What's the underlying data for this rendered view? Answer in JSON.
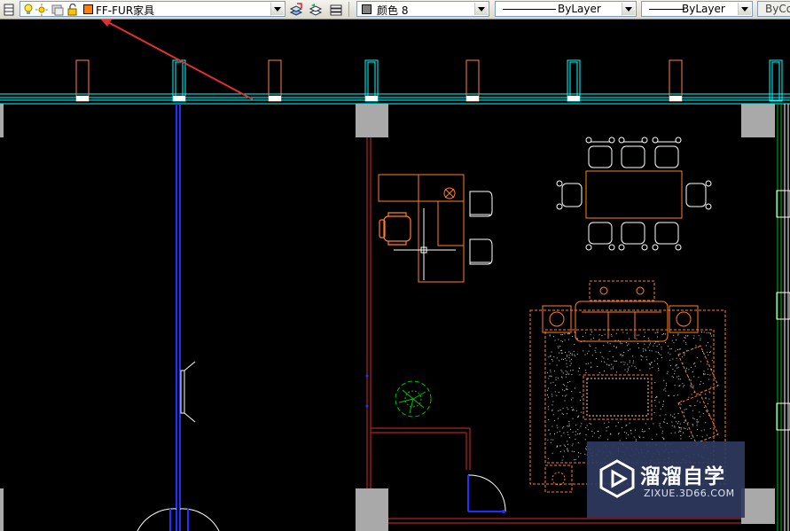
{
  "toolbar": {
    "layer_name": "FF-FUR家具",
    "layer_color": "#ff7f00",
    "color_label": "颜色 8",
    "color_swatch": "#808080",
    "linetype": "ByLayer",
    "lineweight": "ByLayer",
    "plotstyle": "ByCo"
  },
  "icons": {
    "layer_manager": "layer-properties-icon",
    "bulb": "layer-on-bulb-icon",
    "sun": "layer-thaw-sun-icon",
    "lock": "layer-unlock-icon",
    "make_current": "make-object-layer-current-icon",
    "layer_previous": "layer-previous-icon",
    "layer_states": "layer-states-icon"
  },
  "watermark": {
    "title": "溜溜自学",
    "subtitle": "ZIXUE.3D66.COM"
  },
  "colors": {
    "background": "#000000",
    "cyan_wall": "#00ffff",
    "furniture": "#ff7f27",
    "wall_red": "#b22222",
    "column": "#a0a0a0",
    "blue_wall": "#2030ff",
    "white": "#ffffff",
    "green_plant": "#00c000",
    "pointer_arrow": "#e03030"
  }
}
